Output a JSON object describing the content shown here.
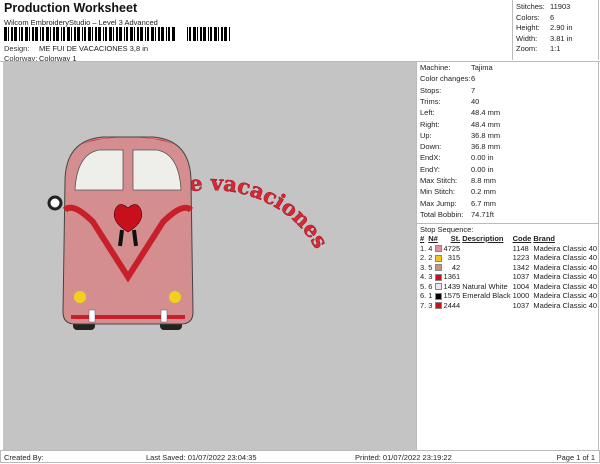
{
  "header": {
    "title": "Production Worksheet",
    "subtitle": "Wilcom EmbroideryStudio – Level 3 Advanced",
    "design_label": "Design:",
    "design_value": "ME FUI DE VACACIONES 3,8 in",
    "colorway_label": "Colorway:",
    "colorway_value": "Colorway 1"
  },
  "summary": [
    {
      "k": "Stitches:",
      "v": "11903"
    },
    {
      "k": "Colors:",
      "v": "6"
    },
    {
      "k": "Height:",
      "v": "2.90 in"
    },
    {
      "k": "Width:",
      "v": "3.81 in"
    },
    {
      "k": "Zoom:",
      "v": "1:1"
    }
  ],
  "machine": [
    {
      "k": "Machine:",
      "v": "Tajima"
    },
    {
      "k": "Color changes:",
      "v": "6"
    },
    {
      "k": "Stops:",
      "v": "7"
    },
    {
      "k": "Trims:",
      "v": "40"
    },
    {
      "k": "Left:",
      "v": "48.4 mm"
    },
    {
      "k": "Right:",
      "v": "48.4 mm"
    },
    {
      "k": "Up:",
      "v": "36.8 mm"
    },
    {
      "k": "Down:",
      "v": "36.8 mm"
    },
    {
      "k": "EndX:",
      "v": "0.00 in"
    },
    {
      "k": "EndY:",
      "v": "0.00 in"
    },
    {
      "k": "Max Stitch:",
      "v": "8.8 mm"
    },
    {
      "k": "Min Stitch:",
      "v": "0.2 mm"
    },
    {
      "k": "Max Jump:",
      "v": "6.7 mm"
    },
    {
      "k": "Total Bobbin:",
      "v": "74.71ft"
    }
  ],
  "stop_sequence": {
    "title": "Stop Sequence:",
    "headers": [
      "#",
      "N#",
      "St.",
      "Description",
      "Code",
      "Brand"
    ],
    "rows": [
      {
        "num": "1.",
        "n": "4",
        "color": "#e0909c",
        "st": "4725",
        "desc": "",
        "code": "1148",
        "brand": "Madeira Classic 40"
      },
      {
        "num": "2.",
        "n": "2",
        "color": "#f2c41e",
        "st": "315",
        "desc": "",
        "code": "1223",
        "brand": "Madeira Classic 40"
      },
      {
        "num": "3.",
        "n": "5",
        "color": "#c8907c",
        "st": "42",
        "desc": "",
        "code": "1342",
        "brand": "Madeira Classic 40"
      },
      {
        "num": "4.",
        "n": "3",
        "color": "#c8101c",
        "st": "1361",
        "desc": "",
        "code": "1037",
        "brand": "Madeira Classic 40"
      },
      {
        "num": "5.",
        "n": "6",
        "color": "#e8e8f0",
        "st": "1439",
        "desc": "Natural White",
        "code": "1004",
        "brand": "Madeira Classic 40"
      },
      {
        "num": "6.",
        "n": "1",
        "color": "#000000",
        "st": "1575",
        "desc": "Emerald Black",
        "code": "1000",
        "brand": "Madeira Classic 40"
      },
      {
        "num": "7.",
        "n": "3",
        "color": "#c8101c",
        "st": "2444",
        "desc": "",
        "code": "1037",
        "brand": "Madeira Classic 40"
      }
    ]
  },
  "design_text": "me fui de vacaciones",
  "footer": {
    "created": "Created By:",
    "saved": "Last Saved: 01/07/2022 23:04:35",
    "printed": "Printed: 01/07/2022 23:19:22",
    "page": "Page 1 of 1"
  }
}
